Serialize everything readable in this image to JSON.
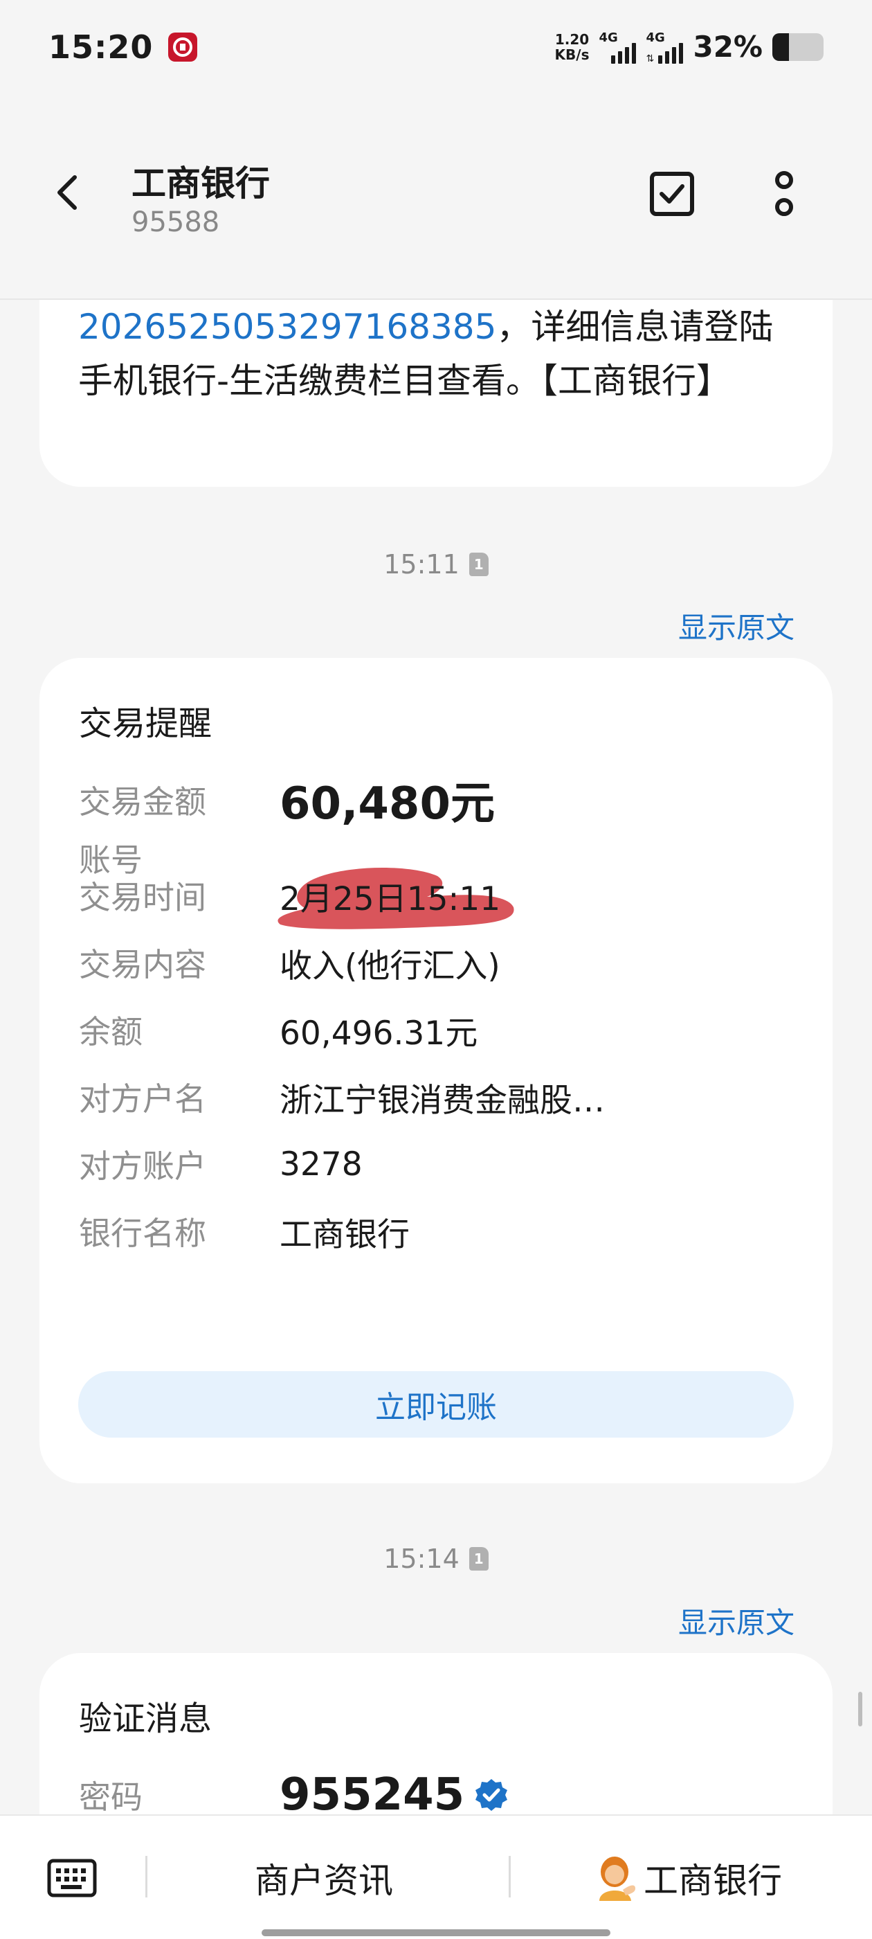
{
  "status_bar": {
    "time": "15:20",
    "net_speed_value": "1.20",
    "net_speed_unit": "KB/s",
    "signal1_type": "4G",
    "signal2_type": "4G",
    "battery_percent": "32%",
    "battery_level": 0.32
  },
  "header": {
    "contact_name": "工商银行",
    "contact_number": "95588"
  },
  "previous_message": {
    "link_text": "2026525053297168385",
    "text_after_link": "，详细信息请登陆手机银行-生活缴费栏目查看。【工商银行】"
  },
  "transaction_message": {
    "timestamp": "15:11",
    "sim_slot": "1",
    "show_original_label": "显示原文",
    "card_title": "交易提醒",
    "fields": [
      {
        "label": "交易金额",
        "value": "60,480元"
      },
      {
        "label": "账号",
        "value": ""
      },
      {
        "label": "交易时间",
        "value": "2月25日15:11"
      },
      {
        "label": "交易内容",
        "value": "收入(他行汇入)"
      },
      {
        "label": "余额",
        "value": "60,496.31元"
      },
      {
        "label": "对方户名",
        "value": "浙江宁银消费金融股…"
      },
      {
        "label": "对方账户",
        "value": "3278"
      },
      {
        "label": "银行名称",
        "value": "工商银行"
      }
    ],
    "record_button_label": "立即记账"
  },
  "verification_message": {
    "timestamp": "15:14",
    "sim_slot": "1",
    "show_original_label": "显示原文",
    "card_title": "验证消息",
    "code_label": "密码",
    "code_value": "955245"
  },
  "bottom_bar": {
    "merchant_news_label": "商户资讯",
    "bank_menu_label": "工商银行"
  },
  "colors": {
    "link_blue": "#1e73c8",
    "background": "#f5f5f5",
    "card_bg": "#ffffff",
    "record_button_bg": "#e6f2fd",
    "redaction_red": "#d9555b",
    "brand_red": "#c7162b"
  }
}
